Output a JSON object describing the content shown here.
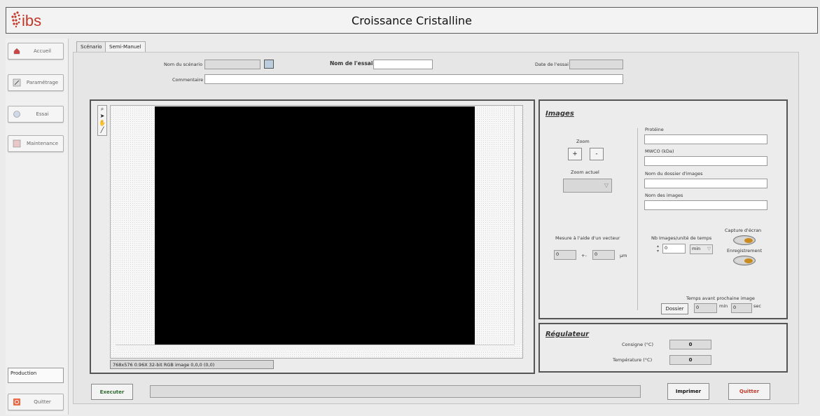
{
  "window": {
    "title": "Croissance Cristalline",
    "logo_text": "ibs"
  },
  "sidebar": {
    "items": [
      {
        "label": "Accueil",
        "icon": "home-icon"
      },
      {
        "label": "Paramétrage",
        "icon": "settings-icon"
      },
      {
        "label": "Essai",
        "icon": "test-icon"
      },
      {
        "label": "Maintenance",
        "icon": "maintenance-icon"
      }
    ],
    "production_label": "Production",
    "quit_label": "Quitter"
  },
  "tabs": [
    {
      "label": "Scénario"
    },
    {
      "label": "Semi-Manuel"
    }
  ],
  "header": {
    "scenario_name_label": "Nom du scénario",
    "scenario_name_value": "",
    "test_name_label": "Nom de l'essai",
    "test_name_value": "",
    "test_date_label": "Date de l'essai",
    "test_date_value": "",
    "comment_label": "Commentaire",
    "comment_value": ""
  },
  "image_display": {
    "status_text": "768x576 0.96X 32-bit RGB image 0,0,0    (0,0)"
  },
  "images_panel": {
    "title": "Images",
    "zoom_label": "Zoom",
    "zoom_in": "+",
    "zoom_out": "-",
    "zoom_current_label": "Zoom actuel",
    "measure_label": "Mesure à l'aide d'un vecteur",
    "measure_value_1": "0",
    "measure_separator": "+-",
    "measure_value_2": "0",
    "measure_unit": "µm",
    "protein_label": "Protéine",
    "mwco_label": "MWCO (kDa)",
    "folder_label": "Nom du dossier d'images",
    "images_name_label": "Nom des images",
    "nb_images_label": "Nb Images/unité de temps",
    "nb_images_value": "0",
    "nb_images_unit": "min",
    "capture_label": "Capture d'écran",
    "record_label": "Enregistrement",
    "next_image_label": "Temps avant prochaine image",
    "folder_button": "Dossier",
    "min_value": "0",
    "min_unit": "min",
    "sec_value": "0",
    "sec_unit": "sec"
  },
  "regulator_panel": {
    "title": "Régulateur",
    "setpoint_label": "Consigne (°C)",
    "setpoint_value": "0",
    "temperature_label": "Température (°C)",
    "temperature_value": "0"
  },
  "footer": {
    "execute": "Executer",
    "print": "Imprimer",
    "quit": "Quitter"
  }
}
